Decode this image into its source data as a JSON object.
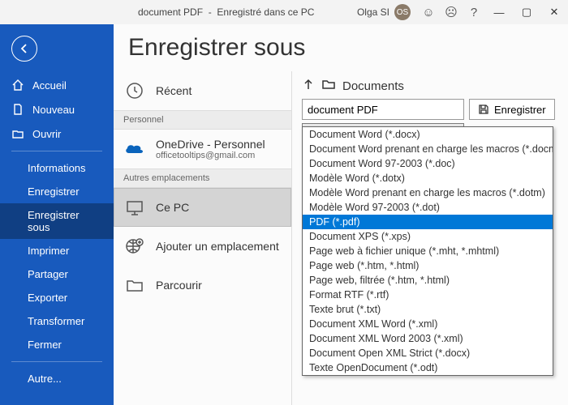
{
  "titlebar": {
    "docname": "document PDF",
    "savestatus": "Enregistré dans ce PC",
    "user": "Olga SI",
    "initials": "OS"
  },
  "heading": "Enregistrer sous",
  "sidebar": {
    "home": "Accueil",
    "new": "Nouveau",
    "open": "Ouvrir",
    "items": [
      "Informations",
      "Enregistrer",
      "Enregistrer sous",
      "Imprimer",
      "Partager",
      "Exporter",
      "Transformer",
      "Fermer"
    ],
    "more": "Autre..."
  },
  "locs": {
    "recent": "Récent",
    "personal_h": "Personnel",
    "onedrive": "OneDrive - Personnel",
    "onedrive_email": "officetooltips@gmail.com",
    "other_h": "Autres emplacements",
    "thispc": "Ce PC",
    "addplace": "Ajouter un emplacement",
    "browse": "Parcourir"
  },
  "right": {
    "path": "Documents",
    "filename": "document PDF",
    "selected_type": "Document Word (*.docx)",
    "save": "Enregistrer"
  },
  "filetypes": [
    "Document Word (*.docx)",
    "Document Word prenant en charge les macros (*.docm)",
    "Document Word 97-2003 (*.doc)",
    "Modèle Word (*.dotx)",
    "Modèle Word prenant en charge les macros (*.dotm)",
    "Modèle Word 97-2003 (*.dot)",
    "PDF (*.pdf)",
    "Document XPS (*.xps)",
    "Page web à fichier unique (*.mht, *.mhtml)",
    "Page web (*.htm, *.html)",
    "Page web, filtrée (*.htm, *.html)",
    "Format RTF (*.rtf)",
    "Texte brut (*.txt)",
    "Document XML Word (*.xml)",
    "Document XML Word 2003 (*.xml)",
    "Document Open XML Strict (*.docx)",
    "Texte OpenDocument (*.odt)"
  ],
  "filetype_hl": 6
}
